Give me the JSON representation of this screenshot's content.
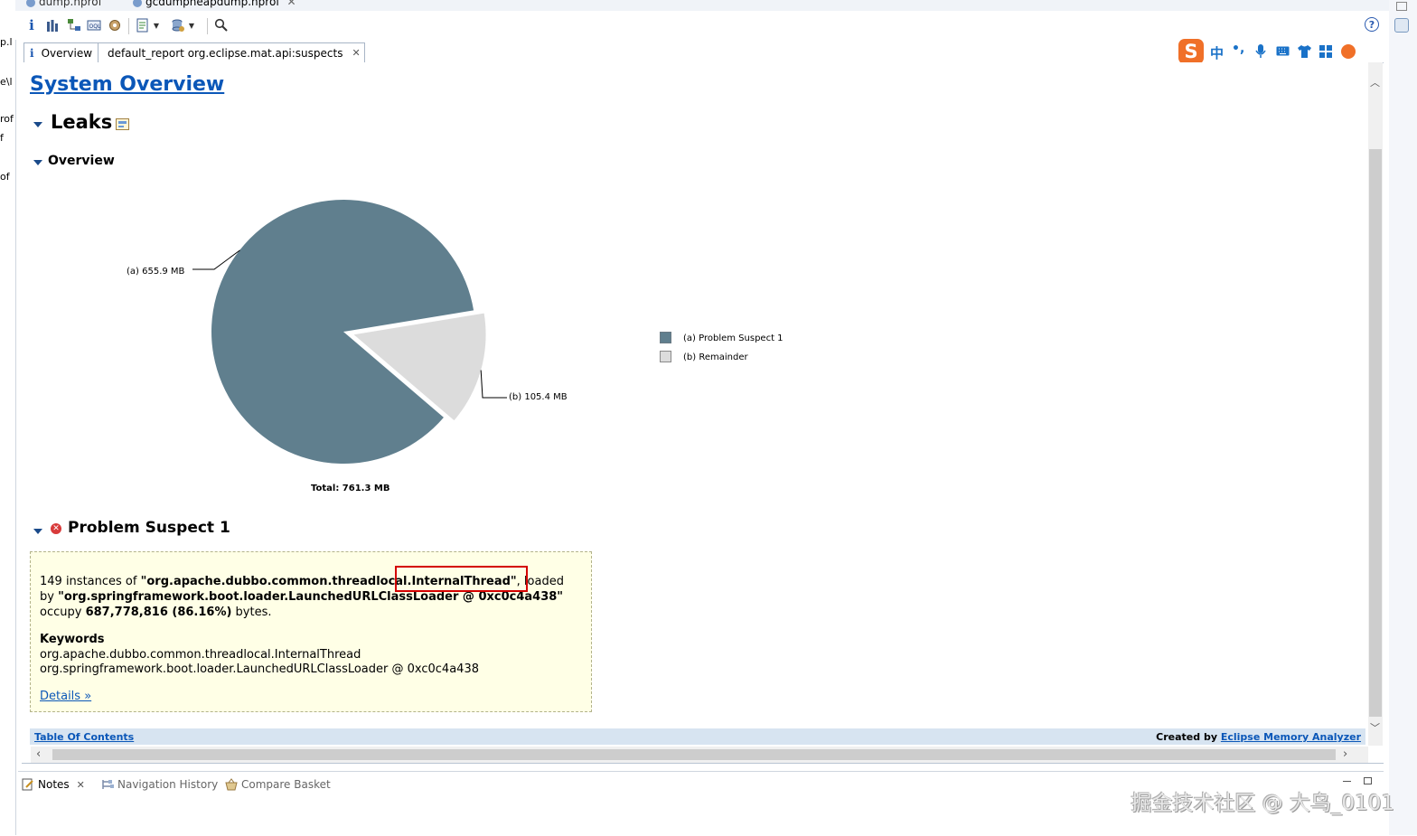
{
  "editor_tabs": [
    {
      "label": "dump.hprof"
    },
    {
      "label": "gcdumpheapdump.hprof"
    }
  ],
  "left_panel_fragments": [
    "p.l",
    "e\\l",
    "rof",
    "f",
    "of"
  ],
  "inner_tabs": [
    {
      "label": "Overview"
    },
    {
      "label": "default_report  org.eclipse.mat.api:suspects"
    }
  ],
  "report": {
    "title": "System Overview",
    "leaks_heading": "Leaks",
    "overview_heading": "Overview",
    "problem_heading": "Problem Suspect 1",
    "suspect": {
      "prefix": "149 instances of ",
      "class_part1": "\"org.apache.dubbo.common.threadlo",
      "class_part2": "cal.InternalThread\"",
      "loaded": ", loaded",
      "by": "by ",
      "loader": "\"org.springframework.boot.loader.LaunchedURLClassLoader @ 0xc0c4a438\"",
      "occupy": "occupy ",
      "bytes_value": "687,778,816 (86.16%)",
      "bytes_suffix": " bytes.",
      "keywords_heading": "Keywords",
      "keyword_1": "org.apache.dubbo.common.threadlocal.InternalThread",
      "keyword_2": "org.springframework.boot.loader.LaunchedURLClassLoader @ 0xc0c4a438",
      "details_link": "Details »"
    },
    "footer": {
      "toc_link": "Table Of Contents",
      "created_by": "Created by ",
      "mat_link": "Eclipse Memory Analyzer"
    }
  },
  "chart_data": {
    "type": "pie",
    "slices": [
      {
        "label": "(a)  655.9 MB",
        "legend": "(a)  Problem Suspect 1",
        "value": 655.9,
        "color": "#607f8e"
      },
      {
        "label": "(b)  105.4 MB",
        "legend": "(b)  Remainder",
        "value": 105.4,
        "color": "#dcdcdc"
      }
    ],
    "total_label": "Total: 761.3 MB"
  },
  "bottom_tabs": [
    {
      "label": "Notes"
    },
    {
      "label": "Navigation History"
    },
    {
      "label": "Compare Basket"
    }
  ],
  "ime_toolbar": {
    "chinese_label": "中",
    "punct_label": "•,"
  },
  "watermark": "掘金技术社区 @ 大鸟_0101",
  "colors": {
    "link": "#0b57b8",
    "highlight_box": "#d40000",
    "suspect_bg": "#ffffe6",
    "footer_bg": "#d7e4f1"
  }
}
